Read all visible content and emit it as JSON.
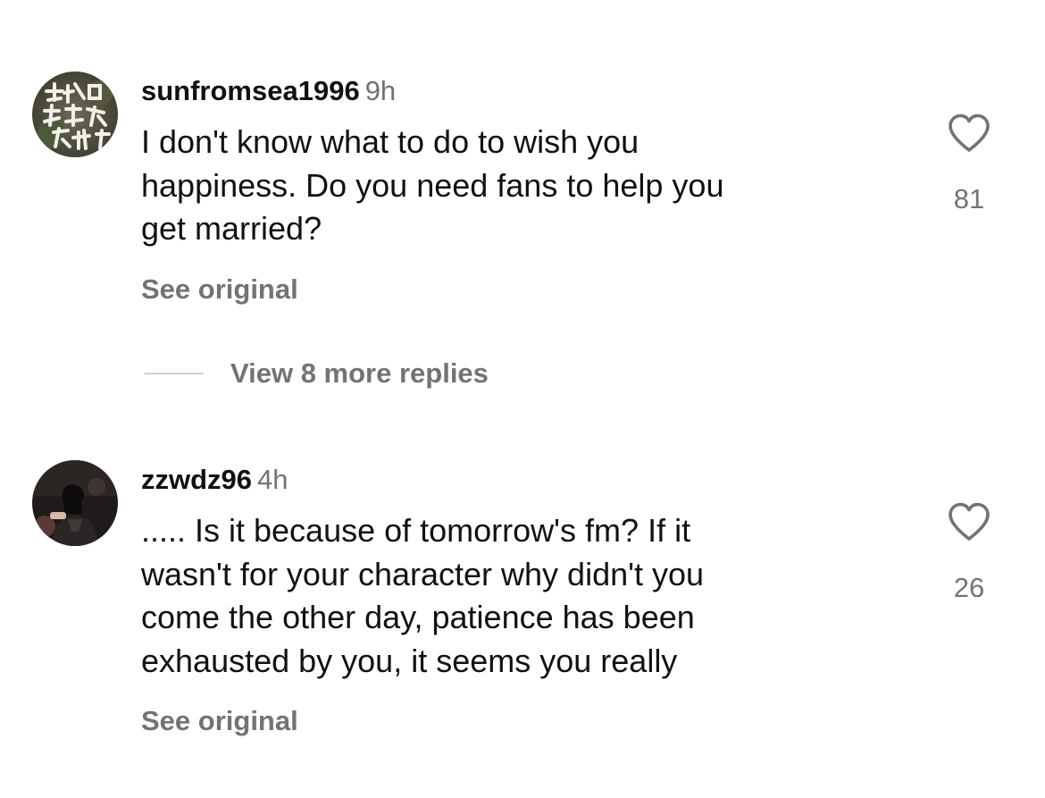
{
  "comments": [
    {
      "username": "sunfromsea1996",
      "time": "9h",
      "lines": [
        "I don't know what to do to wish you",
        "happiness. Do you need fans to help you",
        "get married?"
      ],
      "see_original": "See original",
      "likes": "81",
      "avatar_text": "去做吧 远都会 后悔"
    },
    {
      "username": "zzwdz96",
      "time": "4h",
      "lines": [
        "..... Is it because of tomorrow's fm? If it",
        "wasn't for your character why didn't you",
        "come the other day, patience has been",
        "exhausted by you, it seems you really"
      ],
      "see_original": "See original",
      "likes": "26"
    }
  ],
  "replies": {
    "label": "View 8 more replies"
  },
  "icons": {
    "like": "heart-outline-icon"
  }
}
